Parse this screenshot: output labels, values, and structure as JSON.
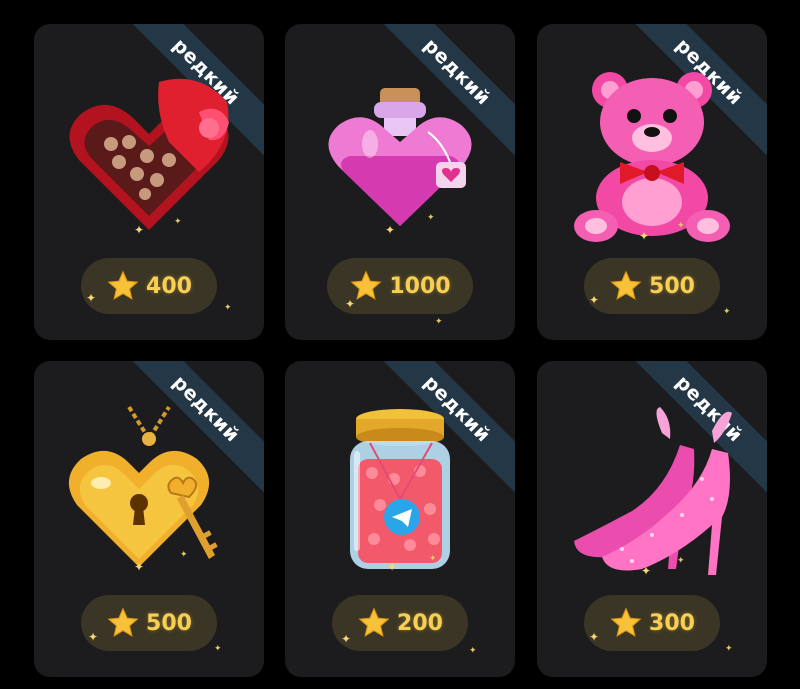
{
  "cards": [
    {
      "badge": "редкий",
      "price": "400",
      "item": "heart-chocolate-box"
    },
    {
      "badge": "редкий",
      "price": "1000",
      "item": "love-potion"
    },
    {
      "badge": "редкий",
      "price": "500",
      "item": "teddy-bear"
    },
    {
      "badge": "редкий",
      "price": "500",
      "item": "golden-heart-locket"
    },
    {
      "badge": "редкий",
      "price": "200",
      "item": "jar-of-hearts"
    },
    {
      "badge": "редкий",
      "price": "300",
      "item": "pink-heels"
    }
  ],
  "colors": {
    "background": "#000000",
    "card": "#1c1c1e",
    "ribbon": "#243746",
    "price_pill": "#3a3524",
    "price_text": "#f8cf55"
  }
}
